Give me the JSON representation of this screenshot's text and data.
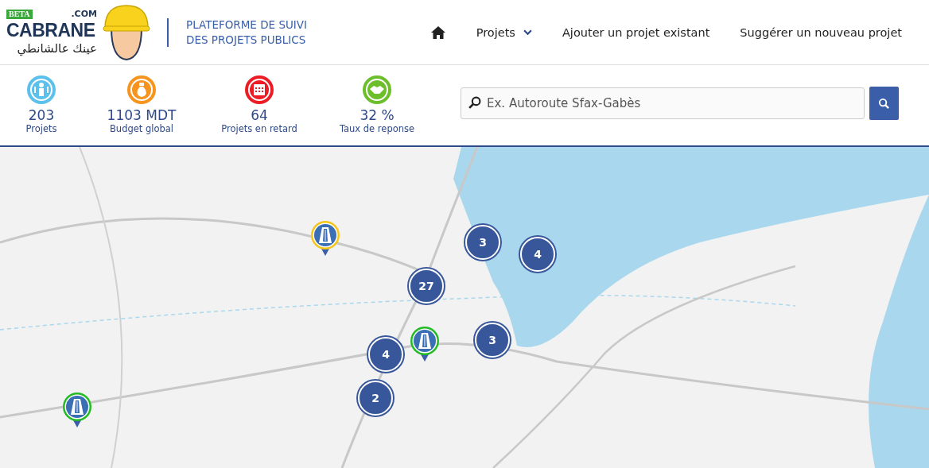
{
  "logo": {
    "badge": "BETA",
    "domain": ".COM",
    "name": "CABRANE",
    "tagline": "عينك عالشانطي"
  },
  "platform_title": [
    "PLATEFORME DE SUIVI",
    "DES PROJETS PUBLICS"
  ],
  "nav": [
    {
      "kind": "home"
    },
    {
      "kind": "dropdown",
      "label": "Projets"
    },
    {
      "kind": "link",
      "label": "Ajouter un projet existant"
    },
    {
      "kind": "link",
      "label": "Suggérer un nouveau projet"
    }
  ],
  "stats": [
    {
      "kind": "workers",
      "color": "#5bc0eb",
      "value": "203",
      "label": "Projets"
    },
    {
      "kind": "money",
      "color": "#f7941d",
      "value": "1103 MDT",
      "label": "Budget global"
    },
    {
      "kind": "calendar",
      "color": "#ed1c24",
      "value": "64",
      "label": "Projets en retard"
    },
    {
      "kind": "handshake",
      "color": "#6cbf2a",
      "value": "32 %",
      "label": "Taux de reponse"
    }
  ],
  "search": {
    "placeholder": "Ex. Autoroute Sfax-Gabès"
  },
  "map": {
    "kind": "picture",
    "markers": [
      {
        "kind": "pin",
        "color": "#f5c518"
      },
      {
        "kind": "cluster",
        "count": "3"
      },
      {
        "kind": "cluster",
        "count": "4"
      },
      {
        "kind": "cluster",
        "count": "27"
      },
      {
        "kind": "pin",
        "color": "#22bb22"
      },
      {
        "kind": "cluster",
        "count": "3"
      },
      {
        "kind": "cluster",
        "count": "4"
      },
      {
        "kind": "cluster",
        "count": "2"
      },
      {
        "kind": "pin",
        "color": "#22bb22"
      }
    ]
  }
}
